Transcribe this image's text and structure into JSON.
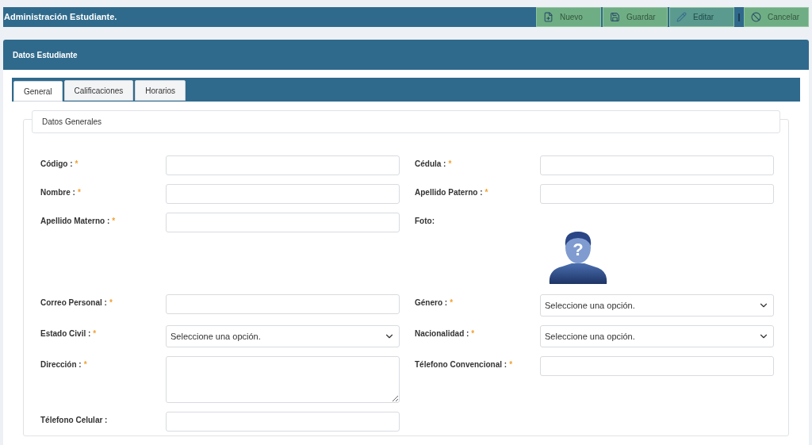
{
  "header": {
    "title": "Administración Estudiante.",
    "buttons": [
      {
        "kind": "new",
        "label": "Nuevo",
        "disabled": false
      },
      {
        "kind": "save",
        "label": "Guardar",
        "disabled": false
      },
      {
        "kind": "edit",
        "label": "Editar",
        "disabled": true
      },
      {
        "kind": "cancel",
        "label": "Cancelar",
        "disabled": false
      }
    ]
  },
  "panel": {
    "title": "Datos Estudiante"
  },
  "tabs": [
    {
      "label": "General",
      "selected": true
    },
    {
      "label": "Calificaciones",
      "selected": false
    },
    {
      "label": "Horarios",
      "selected": false
    }
  ],
  "fieldset": {
    "legend": "Datos Generales"
  },
  "rows": [
    {
      "left": {
        "kind": "text",
        "label": "Código :",
        "mark": "*"
      },
      "right": {
        "kind": "text",
        "label": "Cédula :",
        "mark": "*"
      }
    },
    {
      "left": {
        "kind": "text",
        "label": "Nombre :",
        "mark": "*"
      },
      "right": {
        "kind": "text",
        "label": "Apellido Paterno :",
        "mark": "*"
      }
    },
    {
      "left": {
        "kind": "text",
        "label": "Apellido Materno :",
        "mark": "*"
      },
      "right": {
        "kind": "photo",
        "label": "Foto:",
        "symbol": "?"
      }
    },
    {
      "left": {
        "kind": "text",
        "label": "Correo Personal :",
        "mark": "*"
      },
      "right": {
        "kind": "select",
        "label": "Género :",
        "mark": "*",
        "placeholder": "Seleccione una opción."
      }
    },
    {
      "left": {
        "kind": "select",
        "label": "Estado Civil :",
        "mark": "*",
        "placeholder": "Seleccione una opción."
      },
      "right": {
        "kind": "select",
        "label": "Nacionalidad :",
        "mark": "*",
        "placeholder": "Seleccione una opción."
      }
    },
    {
      "left": {
        "kind": "textarea",
        "label": "Dirección :",
        "mark": "*"
      },
      "right": {
        "kind": "text",
        "label": "Télefono Convencional :",
        "mark": "*"
      }
    },
    {
      "left": {
        "kind": "text",
        "label": "Télefono Celular :"
      }
    }
  ]
}
